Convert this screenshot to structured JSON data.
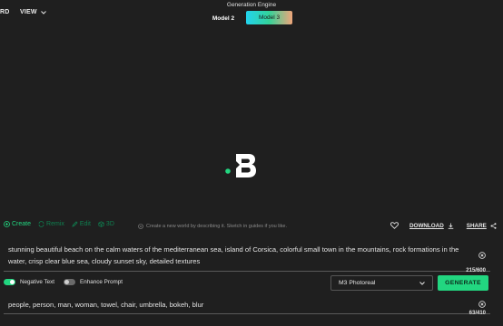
{
  "topbar": {
    "menu_cut": "RD",
    "view_label": "VIEW",
    "engine_label": "Generation Engine",
    "models": [
      "Model 2",
      "Model 3"
    ],
    "selected_model": "Model 3"
  },
  "tabs": [
    {
      "label": "Create",
      "icon": "create-icon",
      "state": "active"
    },
    {
      "label": "Remix",
      "icon": "remix-icon",
      "state": "inactive"
    },
    {
      "label": "Edit",
      "icon": "edit-icon",
      "state": "inactive"
    },
    {
      "label": "3D",
      "icon": "3d-icon",
      "state": "inactive"
    }
  ],
  "hint": "Create a new world by describing it. Sketch in guides if you like.",
  "actions": {
    "download": "DOWNLOAD",
    "share": "SHARE"
  },
  "prompt": {
    "text": "stunning beautiful beach on the calm waters of the mediterranean sea, island of Corsica, colorful small town in the mountains, rock formations in the water, crisp clear blue sea, cloudy sunset sky, detailed textures",
    "count": "215/600"
  },
  "options": {
    "negative_text": "Negative Text",
    "negative_text_on": true,
    "enhance_prompt": "Enhance Prompt",
    "enhance_prompt_on": false
  },
  "style_select": "M3 Photoreal",
  "generate_label": "GENERATE",
  "negative_prompt": {
    "text": "people, person, man, woman, towel, chair, umbrella, bokeh, blur",
    "count": "63/410"
  },
  "colors": {
    "accent": "#22d680",
    "background": "#1f1f1f"
  }
}
